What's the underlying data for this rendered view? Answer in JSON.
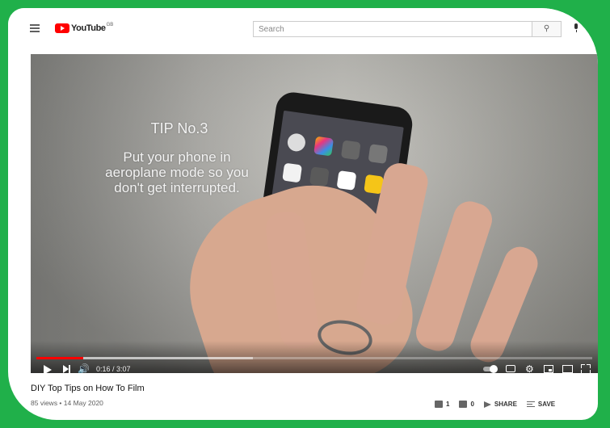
{
  "header": {
    "logo_text": "YouTube",
    "country_code": "GB",
    "search_placeholder": "Search"
  },
  "video": {
    "overlay_title": "TIP No.3",
    "overlay_body_line1": "Put your phone in",
    "overlay_body_line2": "aeroplane mode so you",
    "overlay_body_line3": "don't get interrupted.",
    "current_time": "0:16",
    "duration": "3:07",
    "time_display": "0:16 / 3:07",
    "progress_fraction": 0.085,
    "buffered_fraction": 0.39
  },
  "info": {
    "title": "DIY Top Tips on How To Film",
    "meta": "85 views • 14 May 2020",
    "like_count": "1",
    "dislike_count": "0",
    "share_label": "SHARE",
    "save_label": "SAVE"
  },
  "colors": {
    "frame": "#20b04a",
    "brand_red": "#ff0000"
  }
}
